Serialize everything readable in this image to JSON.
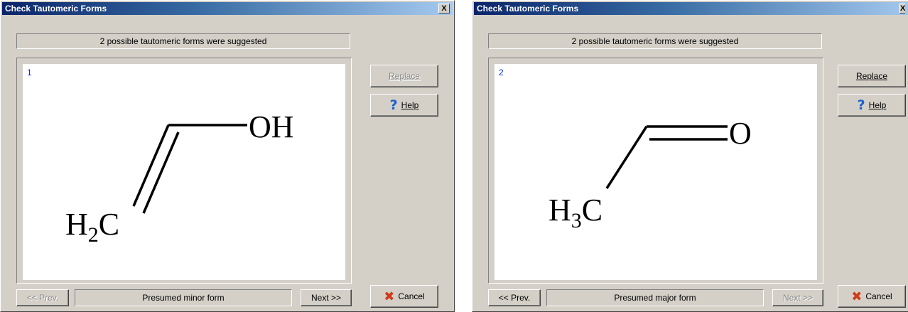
{
  "dialogs": [
    {
      "title": "Check Tautomeric Forms",
      "close_label": "X",
      "status": "2  possible tautomeric forms were suggested",
      "form_index": "1",
      "molecule": {
        "group_right": "OH",
        "group_left_main": "H",
        "group_left_sub": "2",
        "group_left_tail": "C"
      },
      "buttons": {
        "replace": "Replace",
        "replace_enabled": false,
        "help": "Help",
        "cancel": "Cancel",
        "prev": "<< Prev.",
        "prev_enabled": false,
        "next": "Next >>",
        "next_enabled": true
      },
      "form_label": "Presumed minor form"
    },
    {
      "title": "Check Tautomeric Forms",
      "close_label": "X",
      "status": "2  possible tautomeric forms were suggested",
      "form_index": "2",
      "molecule": {
        "group_right": "O",
        "group_left_main": "H",
        "group_left_sub": "3",
        "group_left_tail": "C"
      },
      "buttons": {
        "replace": "Replace",
        "replace_enabled": true,
        "help": "Help",
        "cancel": "Cancel",
        "prev": "<< Prev.",
        "prev_enabled": true,
        "next": "Next >>",
        "next_enabled": false
      },
      "form_label": "Presumed major form"
    }
  ],
  "icons": {
    "help": "question-mark-icon",
    "cancel": "x-mark-icon"
  },
  "colors": {
    "title_bar_start": "#0a246a",
    "title_bar_end": "#a6caf0",
    "form_index": "#0033cc",
    "dialog_face": "#d4d0c8"
  }
}
